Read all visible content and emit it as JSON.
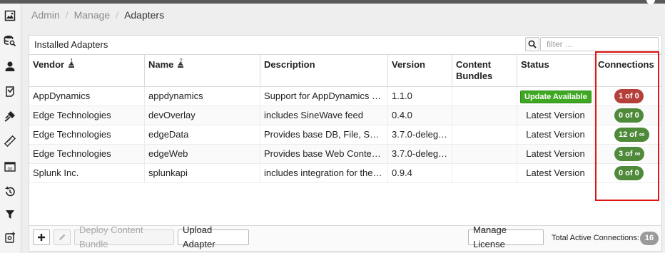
{
  "breadcrumb": {
    "items": [
      "Admin",
      "Manage",
      "Adapters"
    ],
    "separator": "/"
  },
  "panel": {
    "title": "Installed Adapters"
  },
  "filter": {
    "placeholder": "filter ...",
    "value": ""
  },
  "table": {
    "columns": {
      "vendor": "Vendor",
      "name": "Name",
      "description": "Description",
      "version": "Version",
      "content_bundles": "Content Bundles",
      "status": "Status",
      "connections": "Connections"
    },
    "sort_indicators": {
      "vendor": "1",
      "name": "2"
    },
    "rows": [
      {
        "vendor": "AppDynamics",
        "name": "appdynamics",
        "description": "Support for AppDynamics v…",
        "version": "1.1.0",
        "content_bundles": "",
        "status": "Update Available",
        "connections": "1 of 0"
      },
      {
        "vendor": "Edge Technologies",
        "name": "devOverlay",
        "description": "includes SineWave feed",
        "version": "0.4.0",
        "content_bundles": "",
        "status": "Latest Version",
        "connections": "0 of 0"
      },
      {
        "vendor": "Edge Technologies",
        "name": "edgeData",
        "description": "Provides base DB, File, Sh…",
        "version": "3.7.0-deleg…",
        "content_bundles": "",
        "status": "Latest Version",
        "connections": "12 of ∞"
      },
      {
        "vendor": "Edge Technologies",
        "name": "edgeWeb",
        "description": "Provides base Web Content…",
        "version": "3.7.0-deleg…",
        "content_bundles": "",
        "status": "Latest Version",
        "connections": "3 of ∞"
      },
      {
        "vendor": "Splunk Inc.",
        "name": "splunkapi",
        "description": "includes integration for the …",
        "version": "0.9.4",
        "content_bundles": "",
        "status": "Latest Version",
        "connections": "0 of 0"
      }
    ]
  },
  "footer": {
    "deploy_label": "Deploy Content Bundle",
    "upload_label": "Upload Adapter",
    "manage_license_label": "Manage License",
    "total_label": "Total Active Connections:",
    "total_value": "16"
  },
  "colors": {
    "update_available": "#3ea822",
    "badge_warning": "#b5403a",
    "badge_ok": "#4e8a3a",
    "highlight": "#e01414",
    "total_badge": "#9a9a9a"
  },
  "sidebar_icons": [
    "image-icon",
    "database-search-icon",
    "user-icon",
    "certificate-icon",
    "plug-icon",
    "ruler-icon",
    "variable-icon",
    "history-icon",
    "filter-icon",
    "add-settings-icon"
  ]
}
